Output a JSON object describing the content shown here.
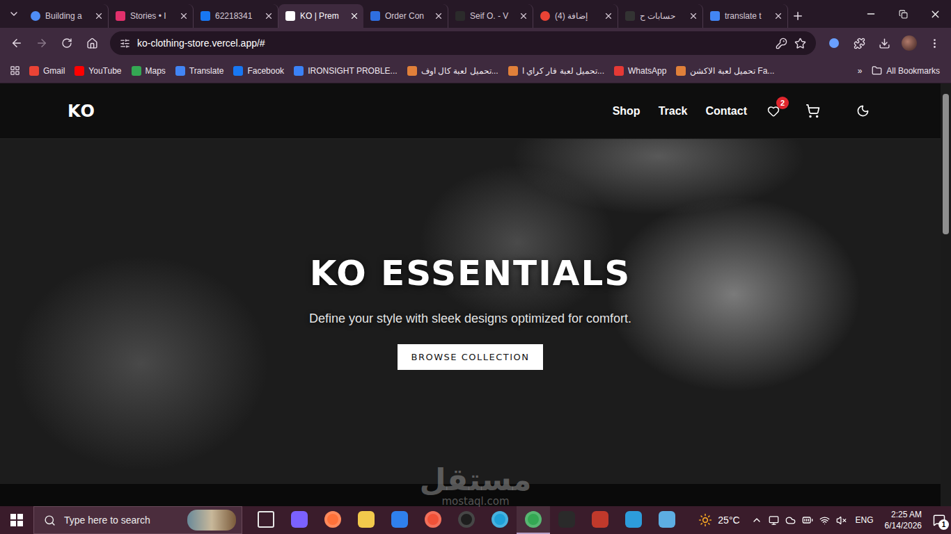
{
  "browser": {
    "tabs": [
      {
        "label": "Building a",
        "selected": false,
        "color": "#4f8df5"
      },
      {
        "label": "Stories • I",
        "selected": false,
        "color": "#e1306c"
      },
      {
        "label": "62218341",
        "selected": false,
        "color": "#1877f2"
      },
      {
        "label": "KO | Prem",
        "selected": true,
        "color": "#ffffff"
      },
      {
        "label": "Order Con",
        "selected": false,
        "color": "#2f6fe0"
      },
      {
        "label": "Seif O. - V",
        "selected": false,
        "color": "#2b2b2b"
      },
      {
        "label": "(4) إضافة",
        "selected": false,
        "color": "#ea4335"
      },
      {
        "label": "حسابات ح",
        "selected": false,
        "color": "#333333"
      },
      {
        "label": "translate t",
        "selected": false,
        "color": "#4285f4"
      }
    ],
    "address": "ko-clothing-store.vercel.app/#",
    "bookmarks": [
      {
        "label": "Gmail",
        "color": "#ea4335"
      },
      {
        "label": "YouTube",
        "color": "#ff0000"
      },
      {
        "label": "Maps",
        "color": "#34a853"
      },
      {
        "label": "Translate",
        "color": "#4285f4"
      },
      {
        "label": "Facebook",
        "color": "#1877f2"
      },
      {
        "label": "IRONSIGHT PROBLE...",
        "color": "#3b82f6"
      },
      {
        "label": "تحميل لعبة كال اوف...",
        "color": "#e0803a"
      },
      {
        "label": "تحميل لعبة فار كراي ا...",
        "color": "#e0803a"
      },
      {
        "label": "WhatsApp",
        "color": "#e53935"
      },
      {
        "label": "تحميل لعبة الاكشن Fa...",
        "color": "#e0803a"
      }
    ],
    "bookmarks_overflow": "»",
    "all_bookmarks": "All Bookmarks"
  },
  "site": {
    "logo": "KO",
    "nav": [
      "Shop",
      "Track",
      "Contact"
    ],
    "wishlist_count": "2",
    "hero": {
      "title": "KO ESSENTIALS",
      "subtitle": "Define your style with sleek designs optimized for comfort.",
      "button": "BROWSE COLLECTION"
    },
    "scrollbar": {
      "level": 0.34
    }
  },
  "watermark": {
    "arabic": "مستقل",
    "latin": "mostaql.com"
  },
  "taskbar": {
    "search_placeholder": "Type here to search",
    "apps": [
      {
        "kind": "outline",
        "color": "#e8e8e8",
        "running": false
      },
      {
        "kind": "tile",
        "color": "#7b61ff",
        "running": false
      },
      {
        "kind": "circle",
        "color": "#ff7139",
        "running": false
      },
      {
        "kind": "tile",
        "color": "#f2c94c",
        "running": false
      },
      {
        "kind": "tile",
        "color": "#2f80ed",
        "running": false
      },
      {
        "kind": "circle",
        "color": "#f05138",
        "running": false
      },
      {
        "kind": "circle",
        "color": "#1e1e1e",
        "running": false
      },
      {
        "kind": "circle",
        "color": "#1fa0d8",
        "running": false
      },
      {
        "kind": "circle",
        "color": "#34a853",
        "running": true
      },
      {
        "kind": "tile",
        "color": "#2a2a2a",
        "running": false
      },
      {
        "kind": "tile",
        "color": "#c0392b",
        "running": false
      },
      {
        "kind": "tile",
        "color": "#2d9cdb",
        "running": false
      },
      {
        "kind": "tile",
        "color": "#5dade2",
        "running": false
      }
    ],
    "weather": "25°C",
    "language": "ENG",
    "time": "2:25 AM",
    "date": "6/14/2026",
    "notifications": "1"
  }
}
